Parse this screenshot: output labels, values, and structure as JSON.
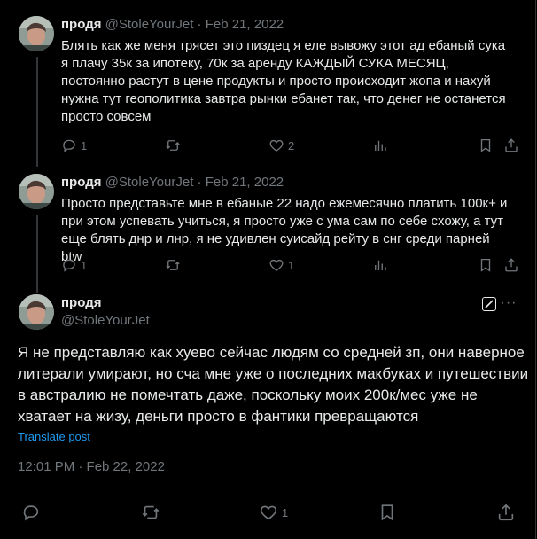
{
  "posts": [
    {
      "name": "продя",
      "handle": "@StoleYourJet",
      "sep": "·",
      "date": "Feb 21, 2022",
      "text": "Блять как же меня трясет это пиздец я еле вывожу этот ад ебаный сука я плачу 35к за ипотеку, 70к за аренду КАЖДЫЙ СУКА МЕСЯЦ, постоянно растут в цене продукты и просто происходит жопа и нахуй нужна тут геополитика завтра рынки ебанет так, что денег не останется просто совсем",
      "replies": "1",
      "reposts": "",
      "likes": "2"
    },
    {
      "name": "продя",
      "handle": "@StoleYourJet",
      "sep": "·",
      "date": "Feb 21, 2022",
      "text": "Просто представьте мне в ебаные 22 надо ежемесячно платить 100к+ и при этом успевать учиться, я просто уже с ума сам по себе схожу, а тут еще блять днр и лнр, я не удивлен суисайд рейту в снг среди парней btw",
      "replies": "1",
      "reposts": "",
      "likes": "1"
    }
  ],
  "focus": {
    "name": "продя",
    "handle": "@StoleYourJet",
    "more": "···",
    "text": "Я не представляю как хуево сейчас людям со средней зп, они наверное литерали умирают, но сча мне уже о последних макбуках и путешествии в австралию не помечтать даже, поскольку моих 200к/мес уже не хватает на жизу, деньги просто в фантики превращаются",
    "translate": "Translate post",
    "timestamp": "12:01 PM · Feb 22, 2022",
    "replies": "",
    "reposts": "",
    "likes": "1"
  },
  "icons": {
    "reply": "reply-icon",
    "repost": "repost-icon",
    "like": "heart-icon",
    "views": "views-icon",
    "bookmark": "bookmark-icon",
    "share": "share-icon",
    "grok": "grok-icon",
    "more": "more-icon"
  },
  "colors": {
    "background": "#000000",
    "text": "#e7e9ea",
    "muted": "#71767b",
    "link": "#1d9bf0",
    "border": "#2f3336"
  }
}
